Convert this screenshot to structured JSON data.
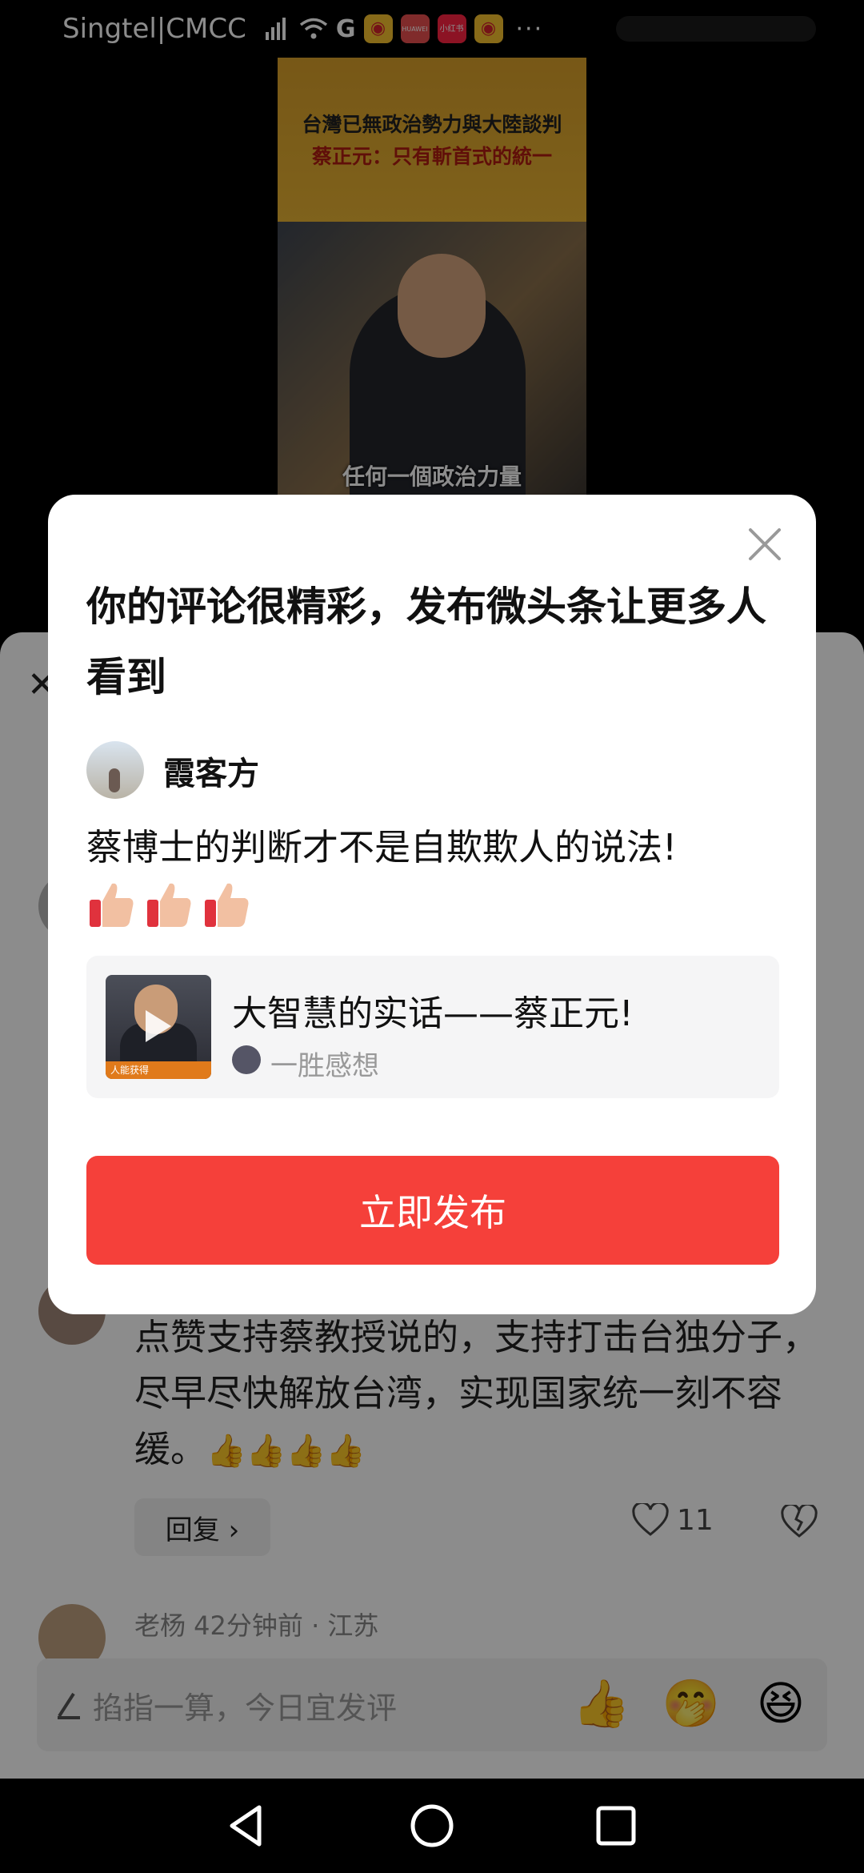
{
  "status_bar": {
    "carrier": "Singtel|CMCC",
    "icons": [
      "signal-icon",
      "wifi-icon",
      "google-icon",
      "weibo-icon",
      "huawei-icon",
      "xiaohongshu-icon",
      "weibo-icon"
    ],
    "huawei_label": "HUAWEI",
    "xhs_label": "小红书",
    "more": "···"
  },
  "video": {
    "title_line1": "台灣已無政治勢力與大陸談判",
    "title_line2": "蔡正元：只有斬首式的統一",
    "subtitle": "任何一個政治力量"
  },
  "background_comment": {
    "text": "点赞支持蔡教授说的，支持打击台独分子，尽早尽快解放台湾，实现国家统一刻不容缓。",
    "reply_label": "回复 ›",
    "like_count": "11",
    "next_commenter": "老杨  42分钟前 · 江苏"
  },
  "input_bar": {
    "placeholder": "掐指一算，今日宜发评",
    "emojis": [
      "👍",
      "🤭",
      "😆"
    ]
  },
  "dialog": {
    "title": "你的评论很精彩，发布微头条让更多人看到",
    "author_name": "霞客方",
    "comment": "蔡博士的判断才不是自欺欺人的说法!",
    "emoji_count": 3,
    "card": {
      "title": "大智慧的实话——蔡正元!",
      "author": "一胜感想",
      "thumb_caption": "人能获得"
    },
    "publish_label": "立即发布"
  },
  "colors": {
    "accent": "#f5403a",
    "dim_overlay": "rgba(0,0,0,0.45)"
  }
}
